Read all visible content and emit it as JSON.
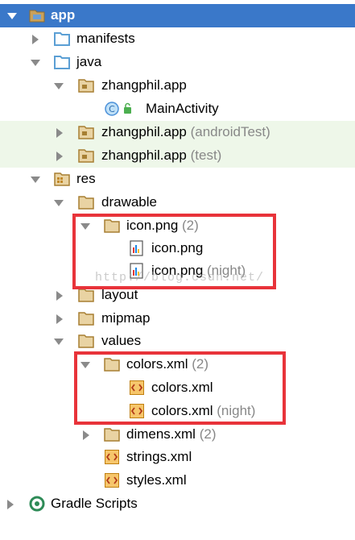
{
  "tree": {
    "app": "app",
    "manifests": "manifests",
    "java": "java",
    "pkg_main": "zhangphil.app",
    "main_activity": "MainActivity",
    "pkg_android_test": "zhangphil.app",
    "pkg_android_test_suffix": "(androidTest)",
    "pkg_test": "zhangphil.app",
    "pkg_test_suffix": "(test)",
    "res": "res",
    "drawable": "drawable",
    "icon_group": "icon.png",
    "icon_group_count": "(2)",
    "icon_png": "icon.png",
    "icon_png_night": "icon.png",
    "icon_png_night_suffix": "(night)",
    "layout": "layout",
    "mipmap": "mipmap",
    "values": "values",
    "colors_group": "colors.xml",
    "colors_group_count": "(2)",
    "colors_xml": "colors.xml",
    "colors_xml_night": "colors.xml",
    "colors_xml_night_suffix": "(night)",
    "dimens_group": "dimens.xml",
    "dimens_group_count": "(2)",
    "strings_xml": "strings.xml",
    "styles_xml": "styles.xml",
    "gradle_scripts": "Gradle Scripts"
  },
  "watermark": "http://blog.csdn.net/",
  "colors": {
    "selection": "#3a78c9",
    "test_highlight": "#eef7e9",
    "annotation_box": "#e8333a",
    "folder": "#c9a15b",
    "blue_folder": "#5b9fd4",
    "class_icon": "#4a90d9"
  }
}
